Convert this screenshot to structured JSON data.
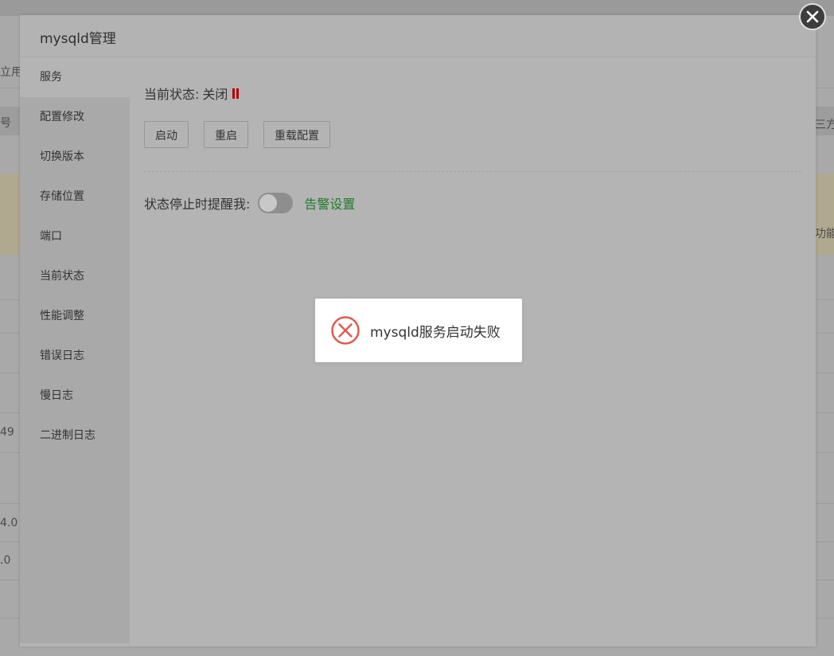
{
  "modal": {
    "title": "mysqld管理",
    "close_icon": "close-icon"
  },
  "sidebar": {
    "items": [
      {
        "label": "服务",
        "active": true
      },
      {
        "label": "配置修改"
      },
      {
        "label": "切换版本"
      },
      {
        "label": "存储位置"
      },
      {
        "label": "端口"
      },
      {
        "label": "当前状态"
      },
      {
        "label": "性能调整"
      },
      {
        "label": "错误日志"
      },
      {
        "label": "慢日志"
      },
      {
        "label": "二进制日志"
      }
    ]
  },
  "service": {
    "status_label": "当前状态:",
    "status_value": "关闭",
    "status_icon": "pause-icon",
    "status_color": "#b00000",
    "buttons": {
      "start": "启动",
      "restart": "重启",
      "reload": "重载配置"
    },
    "alert_label": "状态停止时提醒我:",
    "alert_toggle_on": false,
    "alert_link": "告警设置",
    "alert_link_color": "#1f7a2a"
  },
  "toast": {
    "icon": "error-circle-icon",
    "icon_color": "#e05a4e",
    "message": "mysqld服务启动失败"
  },
  "background": {
    "texts": [
      "立用名",
      "号",
      "三方",
      "功能",
      "49",
      "4.0",
      ".0"
    ]
  }
}
